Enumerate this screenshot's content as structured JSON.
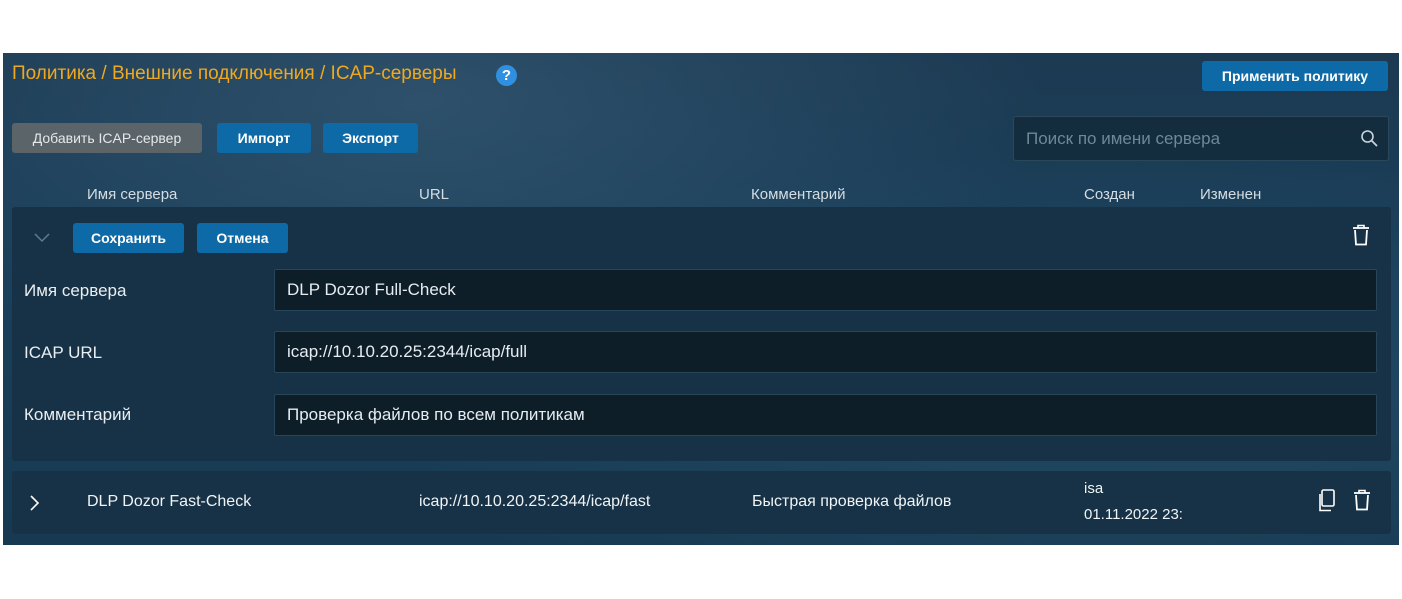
{
  "header": {
    "breadcrumb": "Политика / Внешние подключения / ICAP-серверы",
    "help_icon": "?",
    "apply_button": "Применить политику"
  },
  "toolbar": {
    "add_button": "Добавить ICAP-сервер",
    "import_button": "Импорт",
    "export_button": "Экспорт",
    "search_placeholder": "Поиск по имени сервера"
  },
  "table": {
    "columns": {
      "name": "Имя сервера",
      "url": "URL",
      "comment": "Комментарий",
      "created": "Создан",
      "modified": "Изменен"
    }
  },
  "edit_row": {
    "save_button": "Сохранить",
    "cancel_button": "Отмена",
    "fields": {
      "name_label": "Имя сервера",
      "name_value": "DLP Dozor Full-Check",
      "url_label": "ICAP URL",
      "url_value": "icap://10.10.20.25:2344/icap/full",
      "comment_label": "Комментарий",
      "comment_value": "Проверка файлов по всем политикам"
    }
  },
  "rows": [
    {
      "name": "DLP Dozor Fast-Check",
      "url": "icap://10.10.20.25:2344/icap/fast",
      "comment": "Быстрая проверка файлов",
      "created_by": "isa",
      "created_at": "01.11.2022 23:"
    }
  ],
  "colors": {
    "accent": "#f0a91e",
    "button": "#0e6aa6",
    "background": "#1a3f5a"
  },
  "icons": [
    "help-icon",
    "search-icon",
    "chevron-down-icon",
    "chevron-right-icon",
    "trash-icon",
    "copy-icon"
  ]
}
